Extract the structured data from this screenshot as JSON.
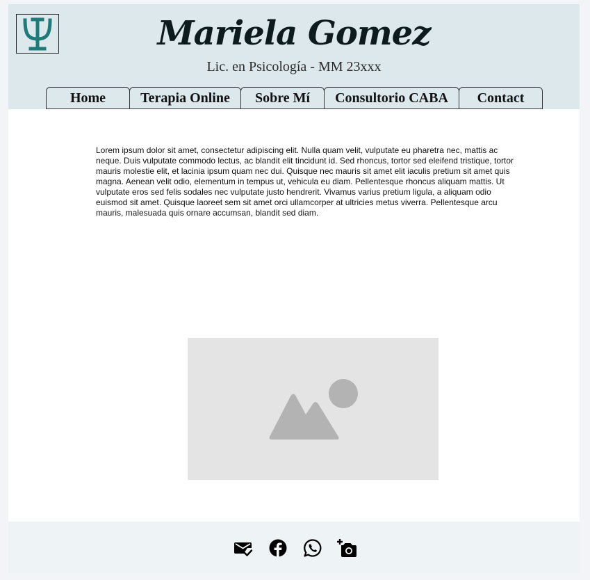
{
  "header": {
    "name": "Mariela Gomez",
    "subtitle": "Lic. en Psicología - MM 23xxx",
    "logo_icon": "psi-icon",
    "logo_color": "#1f7a7a",
    "background": "#dce8ec"
  },
  "nav": {
    "items": [
      {
        "label": "Home"
      },
      {
        "label": "Terapia Online"
      },
      {
        "label": "Sobre Mí"
      },
      {
        "label": "Consultorio CABA"
      },
      {
        "label": "Contact"
      }
    ]
  },
  "main": {
    "paragraph": "Lorem ipsum dolor sit amet, consectetur adipiscing elit. Nulla quam velit, vulputate eu pharetra nec, mattis ac neque. Duis vulputate commodo lectus, ac blandit elit tincidunt id. Sed rhoncus, tortor sed eleifend tristique, tortor mauris molestie elit, et lacinia ipsum quam nec dui. Quisque nec mauris sit amet elit iaculis pretium sit amet quis magna. Aenean velit odio, elementum in tempus ut, vehicula eu diam. Pellentesque rhoncus aliquam mattis. Ut vulputate eros sed felis sodales nec vulputate justo hendrerit. Vivamus varius pretium ligula, a aliquam odio euismod sit amet. Quisque laoreet sem sit amet orci ullamcorper at ultricies metus viverra. Pellentesque arcu mauris, malesuada quis ornare accumsan, blandit sed diam.",
    "image_icon": "image-placeholder-icon"
  },
  "footer": {
    "icons": [
      "email-check-icon",
      "facebook-icon",
      "whatsapp-icon",
      "add-camera-icon"
    ]
  }
}
